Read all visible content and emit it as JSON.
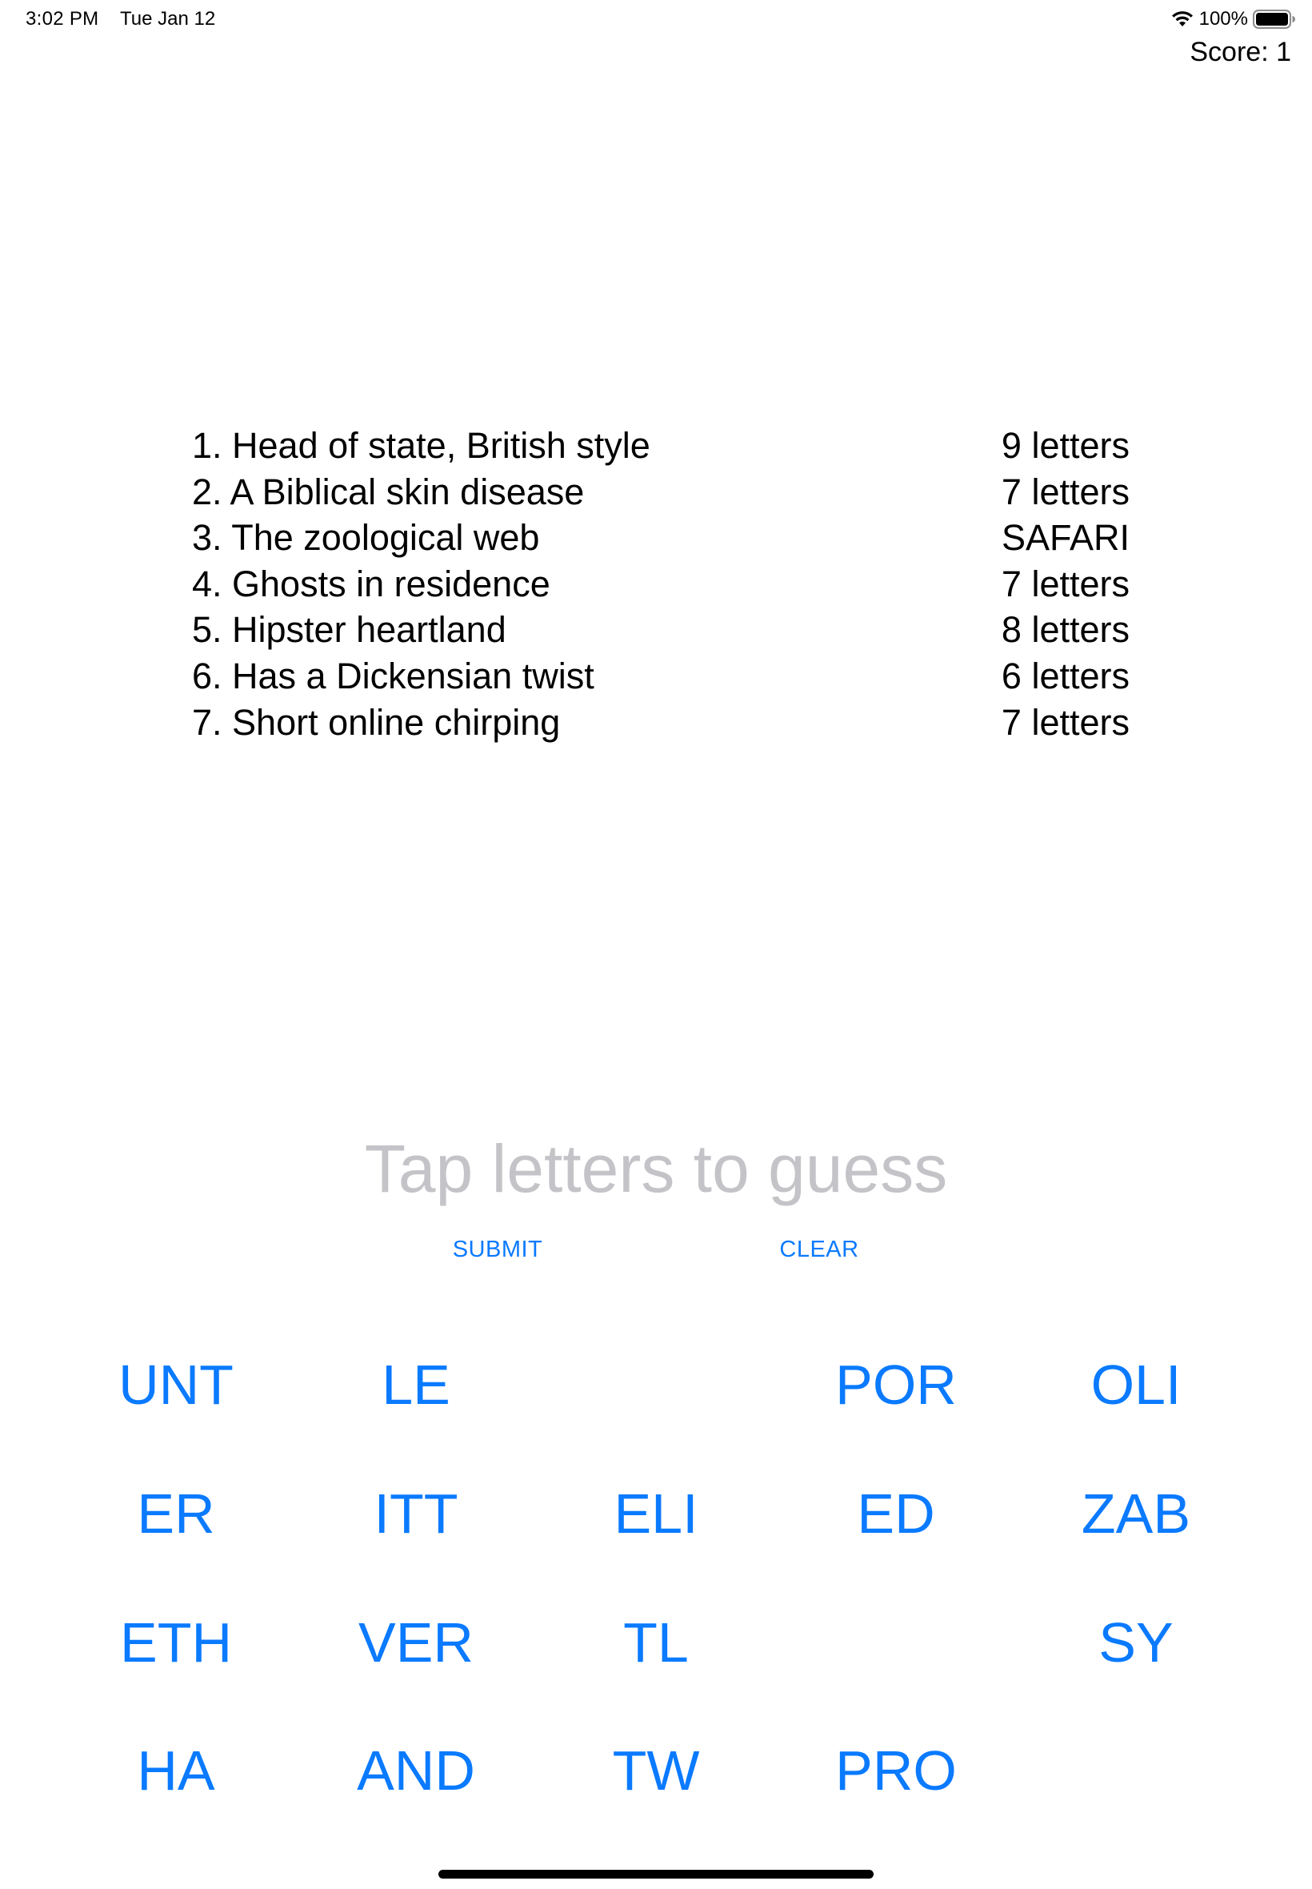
{
  "status_bar": {
    "time": "3:02 PM",
    "date": "Tue Jan 12",
    "battery_percent": "100%",
    "battery_level": 1.0,
    "wifi_icon": "wifi-icon",
    "battery_icon": "battery-icon"
  },
  "score": {
    "label": "Score: 1"
  },
  "clues": [
    {
      "text": "1. Head of state, British style",
      "status": "9 letters"
    },
    {
      "text": "2. A Biblical skin disease",
      "status": "7 letters"
    },
    {
      "text": "3. The zoological web",
      "status": "SAFARI"
    },
    {
      "text": "4. Ghosts in residence",
      "status": "7 letters"
    },
    {
      "text": "5. Hipster heartland",
      "status": "8 letters"
    },
    {
      "text": "6. Has a Dickensian twist",
      "status": "6 letters"
    },
    {
      "text": "7. Short online chirping",
      "status": "7 letters"
    }
  ],
  "guess": {
    "placeholder": "Tap letters to guess"
  },
  "actions": {
    "submit_label": "SUBMIT",
    "clear_label": "CLEAR"
  },
  "tiles": [
    "UNT",
    "LE",
    "",
    "POR",
    "OLI",
    "ER",
    "ITT",
    "ELI",
    "ED",
    "ZAB",
    "ETH",
    "VER",
    "TL",
    "",
    "SY",
    "HA",
    "AND",
    "TW",
    "PRO",
    ""
  ],
  "colors": {
    "accent": "#0a7aff",
    "placeholder": "#c4c4c8",
    "text": "#000000",
    "background": "#ffffff"
  }
}
